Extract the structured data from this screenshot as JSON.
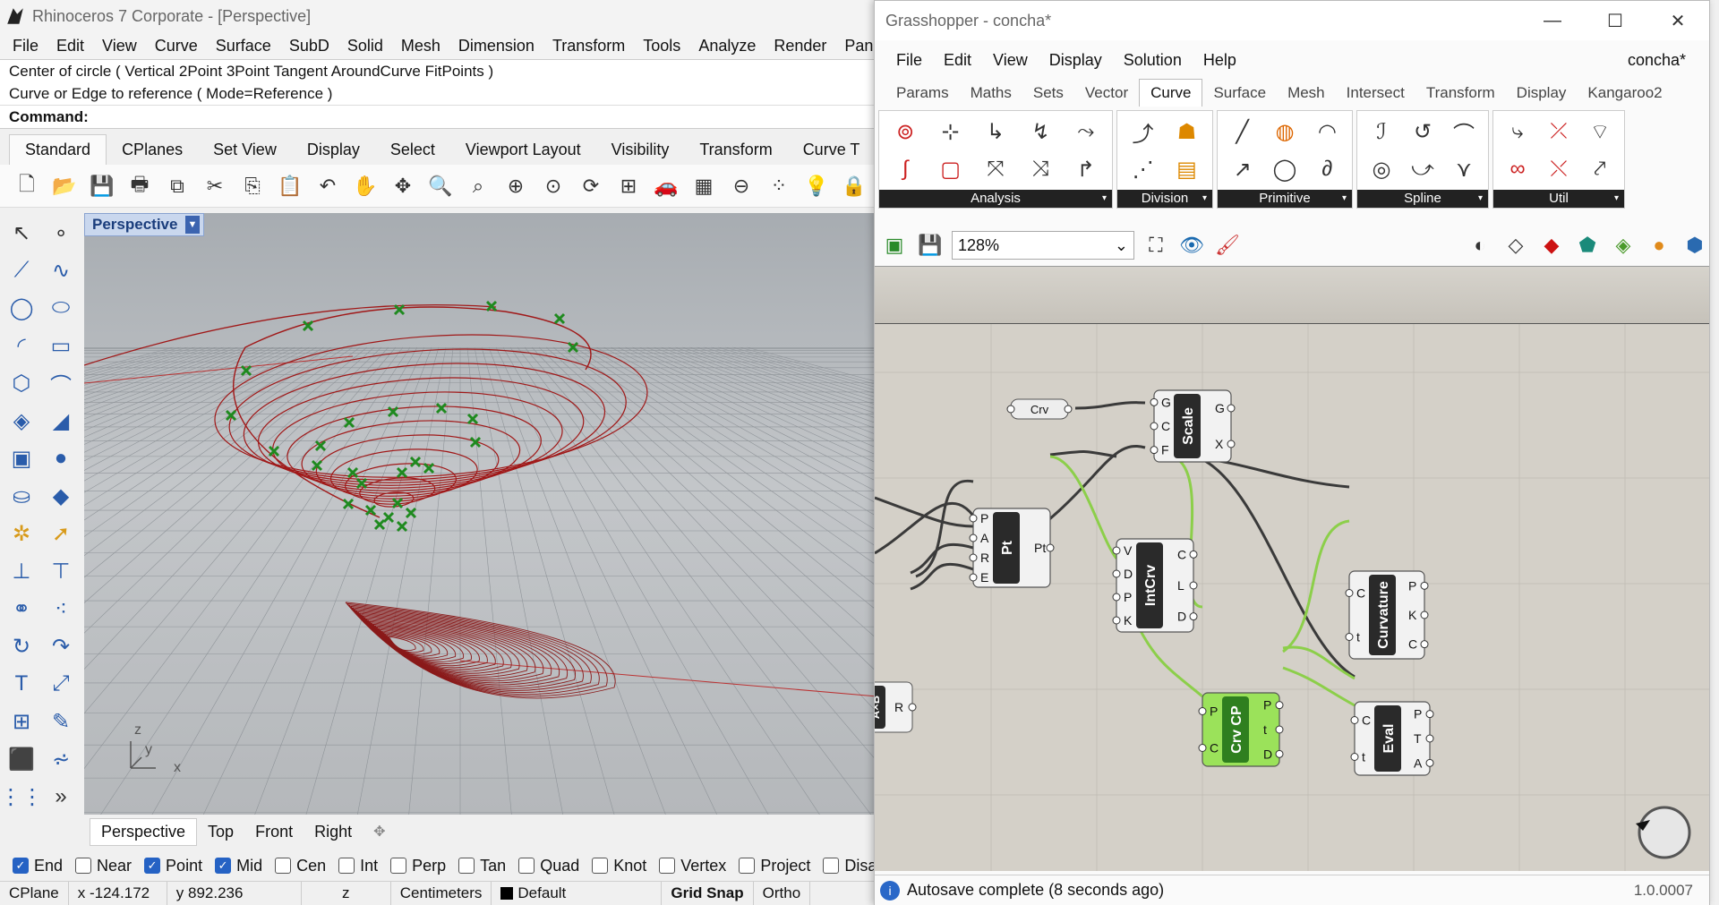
{
  "rhino": {
    "title": "Rhinoceros 7 Corporate - [Perspective]",
    "menu": [
      "File",
      "Edit",
      "View",
      "Curve",
      "Surface",
      "SubD",
      "Solid",
      "Mesh",
      "Dimension",
      "Transform",
      "Tools",
      "Analyze",
      "Render",
      "Pane"
    ],
    "command_history": [
      "Center of circle ( Vertical  2Point  3Point  Tangent  AroundCurve  FitPoints )",
      "Curve or Edge to reference ( Mode=Reference )"
    ],
    "command_label": "Command:",
    "toolbar_tabs": [
      "Standard",
      "CPlanes",
      "Set View",
      "Display",
      "Select",
      "Viewport Layout",
      "Visibility",
      "Transform",
      "Curve T"
    ],
    "active_toolbar_tab": "Standard",
    "toolbar_icons": [
      "new-icon",
      "open-icon",
      "save-icon",
      "print-icon",
      "import-icon",
      "cut-icon",
      "copy-icon",
      "paste-icon",
      "undo-icon",
      "pan-icon",
      "rotate-icon",
      "zoom-icon",
      "zoom-window-icon",
      "zoom-extents-icon",
      "zoom-selected-icon",
      "rotate-view-icon",
      "four-view-icon",
      "car-icon",
      "grid-icon",
      "cplane-icon",
      "points-icon",
      "light-icon",
      "lock-icon"
    ],
    "viewport_label": "Perspective",
    "viewport_tabs": [
      "Perspective",
      "Top",
      "Front",
      "Right"
    ],
    "axes": {
      "x": "x",
      "y": "y",
      "z": "z"
    },
    "osnaps": [
      {
        "label": "End",
        "checked": true
      },
      {
        "label": "Near",
        "checked": false
      },
      {
        "label": "Point",
        "checked": true
      },
      {
        "label": "Mid",
        "checked": true
      },
      {
        "label": "Cen",
        "checked": false
      },
      {
        "label": "Int",
        "checked": false
      },
      {
        "label": "Perp",
        "checked": false
      },
      {
        "label": "Tan",
        "checked": false
      },
      {
        "label": "Quad",
        "checked": false
      },
      {
        "label": "Knot",
        "checked": false
      },
      {
        "label": "Vertex",
        "checked": false
      },
      {
        "label": "Project",
        "checked": false
      },
      {
        "label": "Disable",
        "checked": false
      }
    ],
    "status": {
      "cplane": "CPlane",
      "x": "x -124.172",
      "y": "y 892.236",
      "z": "z",
      "units": "Centimeters",
      "layer": "Default",
      "grid_snap": "Grid Snap",
      "ortho": "Ortho"
    }
  },
  "grasshopper": {
    "title": "Grasshopper - concha*",
    "menu": [
      "File",
      "Edit",
      "View",
      "Display",
      "Solution",
      "Help"
    ],
    "doc_name": "concha*",
    "tabs": [
      "Params",
      "Maths",
      "Sets",
      "Vector",
      "Curve",
      "Surface",
      "Mesh",
      "Intersect",
      "Transform",
      "Display",
      "Kangaroo2"
    ],
    "active_tab": "Curve",
    "panels": [
      {
        "label": "Analysis",
        "count": 10
      },
      {
        "label": "Division",
        "count": 4
      },
      {
        "label": "Primitive",
        "count": 6
      },
      {
        "label": "Spline",
        "count": 6
      },
      {
        "label": "Util",
        "count": 6
      }
    ],
    "zoom": "128%",
    "status_message": "Autosave complete (8 seconds ago)",
    "version": "1.0.0007",
    "components": {
      "crv": {
        "label": "Crv"
      },
      "scale": {
        "label": "Scale",
        "inputs": [
          "G",
          "C",
          "F"
        ],
        "outputs": [
          "G",
          "X"
        ]
      },
      "pt": {
        "label": "Pt",
        "inputs": [
          "P",
          "A",
          "R",
          "E"
        ],
        "outputs": [
          "Pt"
        ]
      },
      "intcrv": {
        "label": "IntCrv",
        "inputs": [
          "V",
          "D",
          "P",
          "K"
        ],
        "outputs": [
          "C",
          "L",
          "D"
        ]
      },
      "curvature": {
        "label": "Curvature",
        "inputs": [
          "C",
          "t"
        ],
        "outputs": [
          "P",
          "K",
          "C"
        ]
      },
      "crvcp": {
        "label": "Crv CP",
        "inputs": [
          "P",
          "C"
        ],
        "outputs": [
          "P",
          "t",
          "D"
        ]
      },
      "eval": {
        "label": "Eval",
        "inputs": [
          "C",
          "t"
        ],
        "outputs": [
          "P",
          "T",
          "A"
        ]
      },
      "axb": {
        "label": "A×B",
        "outputs": [
          "R"
        ]
      }
    }
  },
  "colors": {
    "curve_red": "#a01818",
    "point_green": "#1f8a1f",
    "wire_dark": "#3a3a3a",
    "wire_green": "#8ccf4a",
    "component_dark": "#2a2a2a",
    "component_green": "#8fdc4e"
  }
}
